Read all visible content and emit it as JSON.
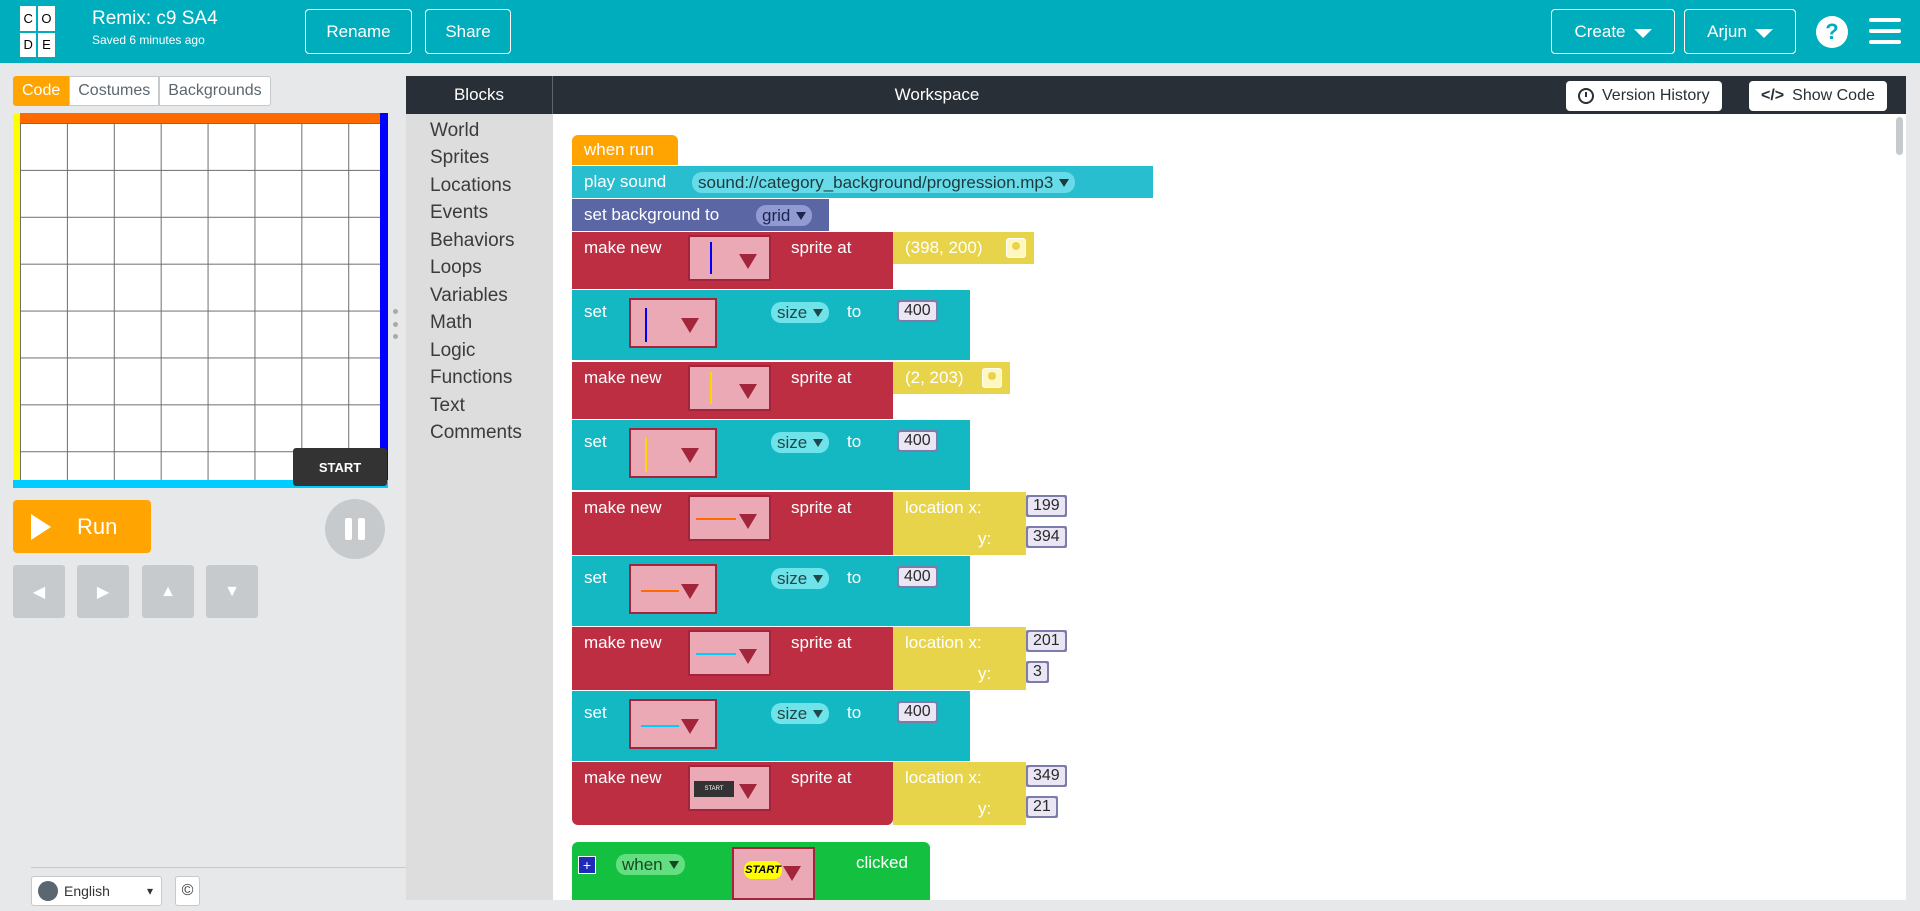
{
  "header": {
    "logo_letters": [
      "C",
      "O",
      "D",
      "E"
    ],
    "project_title": "Remix: c9 SA4",
    "saved_text": "Saved 6 minutes ago",
    "rename_label": "Rename",
    "share_label": "Share",
    "create_label": "Create",
    "user_label": "Arjun",
    "help_label": "?"
  },
  "left_panel": {
    "tabs": [
      "Code",
      "Costumes",
      "Backgrounds"
    ],
    "active_tab": "Code",
    "stage_start_label": "START",
    "run_label": "Run",
    "arrows": [
      "◀",
      "▶",
      "▲",
      "▼"
    ],
    "language": "English",
    "copyright_icon": "©"
  },
  "toolbox": {
    "title": "Blocks",
    "categories": [
      "World",
      "Sprites",
      "Locations",
      "Events",
      "Behaviors",
      "Loops",
      "Variables",
      "Math",
      "Logic",
      "Functions",
      "Text",
      "Comments"
    ]
  },
  "workspace": {
    "title": "Workspace",
    "version_history_label": "Version History",
    "show_code_label": "Show Code"
  },
  "program": {
    "when_run": "when run",
    "play_sound": "play sound",
    "sound_value": "sound://category_background/progression.mp3",
    "set_background": "set background to",
    "background_value": "grid",
    "make_new": "make new",
    "sprite_at": "sprite at",
    "set": "set",
    "size": "size",
    "to": "to",
    "location_x": "location x:",
    "location_y": "y:",
    "point_1": "(398, 200)",
    "point_2": "(2, 203)",
    "size_value": "400",
    "loc_3": {
      "x": "199",
      "y": "394"
    },
    "loc_4": {
      "x": "201",
      "y": "3"
    },
    "loc_5": {
      "x": "349",
      "y": "21"
    },
    "when": "when",
    "clicked": "clicked",
    "start_sprite": "START",
    "colors": {
      "event": "#ffa400",
      "sound": "#29bdd0",
      "background": "#5b67a5",
      "make": "#bd2e43",
      "set": "#13b8c3",
      "location": "#e8d44a",
      "when_clicked": "#13c040",
      "line_blue": "#0000ff",
      "line_yellow": "#ffd700",
      "line_orange": "#ff6a00",
      "line_cyan": "#00ccff"
    }
  }
}
